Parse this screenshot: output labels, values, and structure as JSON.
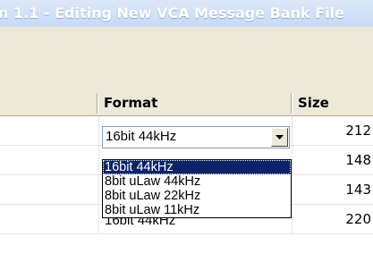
{
  "window": {
    "title": "n 1.1 - Editing New VCA Message Bank File"
  },
  "table": {
    "columns": [
      "Format",
      "Size"
    ],
    "rows": [
      {
        "format": "16bit 44kHz",
        "size": "212"
      },
      {
        "format": "",
        "size": "148"
      },
      {
        "format": "",
        "size": "143"
      },
      {
        "format": "16bit 44kHz",
        "size": "220"
      }
    ]
  },
  "combo": {
    "value": "16bit 44kHz",
    "options": [
      "16bit 44kHz",
      "8bit uLaw 44kHz",
      "8bit uLaw 22kHz",
      "8bit uLaw 11kHz"
    ],
    "selected_index": 0
  },
  "colors": {
    "selection": "#0a246a",
    "header_bg": "#ece9d8"
  }
}
